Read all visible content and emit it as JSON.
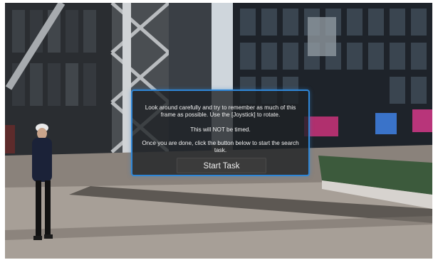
{
  "dialog": {
    "instructions": "Look around carefully and try to remember as much of this frame as possible. Use the [Joystick] to rotate.",
    "timing_note": "This will NOT be timed.",
    "done_note": "Once you are done, click the button below to start the search task.",
    "start_button_label": "Start Task",
    "accent_color": "#2f86d6"
  }
}
